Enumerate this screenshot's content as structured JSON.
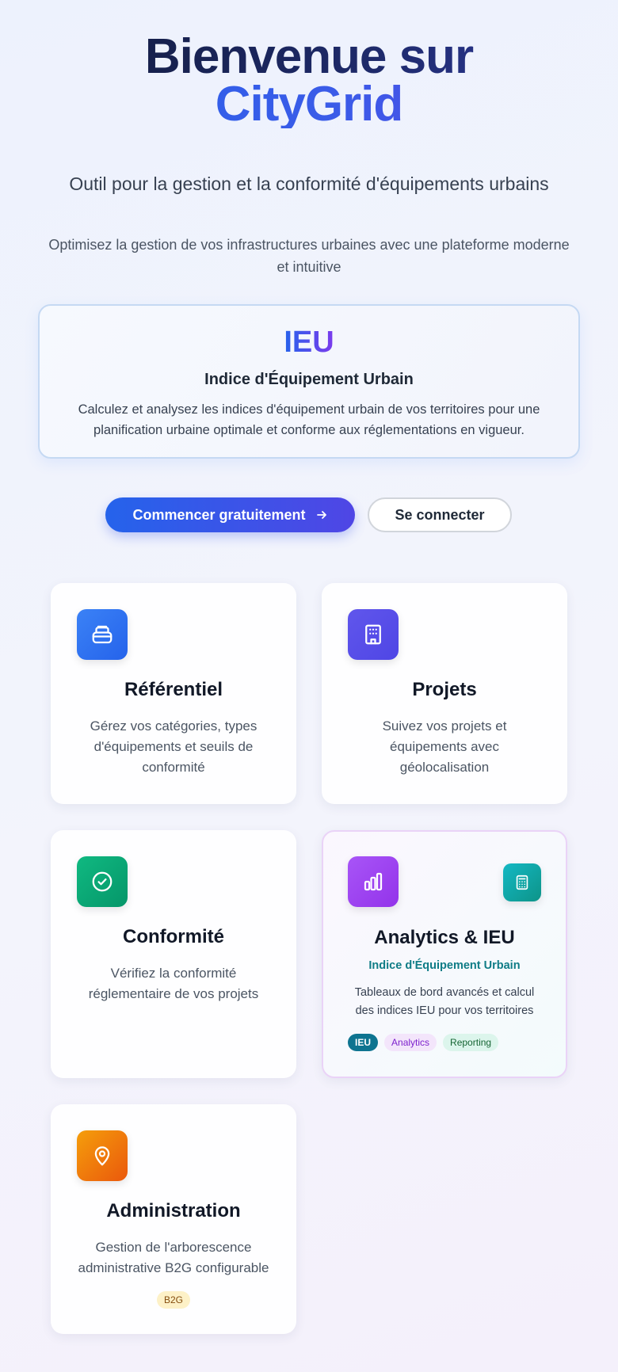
{
  "hero": {
    "title_line1": "Bienvenue sur",
    "title_line2": "CityGrid",
    "subtitle": "Outil pour la gestion et la conformité d'équipements urbains",
    "description": "Optimisez la gestion de vos infrastructures urbaines avec une plateforme moderne et intuitive"
  },
  "ieu": {
    "title": "IEU",
    "subtitle": "Indice d'Équipement Urbain",
    "text": "Calculez et analysez les indices d'équipement urbain de vos territoires pour une planification urbaine optimale et conforme aux réglementations en vigueur."
  },
  "actions": {
    "primary_label": "Commencer gratuitement",
    "secondary_label": "Se connecter"
  },
  "cards": [
    {
      "title": "Référentiel",
      "description": "Gérez vos catégories, types d'équipements et seuils de conformité",
      "icon": "box-icon",
      "color": "#3b82f6"
    },
    {
      "title": "Projets",
      "description": "Suivez vos projets et équipements avec géolocalisation",
      "icon": "building-icon",
      "color": "#5b4ee6"
    },
    {
      "title": "Conformité",
      "description": "Vérifiez la conformité réglementaire de vos projets",
      "icon": "check-circle-icon",
      "color": "#10a36e"
    },
    {
      "title": "Analytics & IEU",
      "subtitle": "Indice d'Équipement Urbain",
      "description": "Tableaux de bord avancés et calcul des indices IEU pour vos territoires",
      "icon": "bar-chart-icon",
      "secondary_icon": "calculator-icon",
      "color": "#a244e8",
      "tags": [
        "IEU",
        "Analytics",
        "Reporting"
      ]
    },
    {
      "title": "Administration",
      "description": "Gestion de l'arborescence administrative B2G configurable",
      "icon": "map-pin-icon",
      "color": "#f0780f",
      "tags": [
        "B2G"
      ]
    }
  ]
}
